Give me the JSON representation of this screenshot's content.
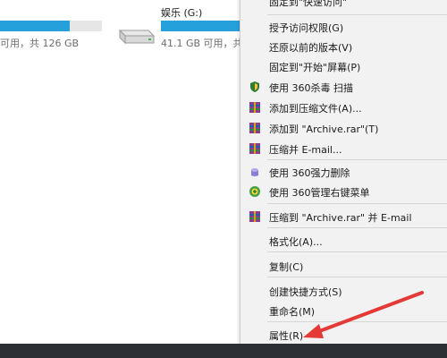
{
  "drives": {
    "c": {
      "used_fraction": 0.68,
      "info": "可用，共 126 GB",
      "bar_color": "#26a0da"
    },
    "g": {
      "name": "娱乐 (G:)",
      "info": "41.1 GB 可用，共",
      "used_fraction": 1.0,
      "icon": "hard-drive-icon",
      "bar_color": "#26a0da"
    }
  },
  "context_menu": {
    "items": [
      {
        "label": "固定到\"快速访问\"",
        "icon": ""
      },
      {
        "label": "授予访问权限(G)",
        "icon": ""
      },
      {
        "label": "还原以前的版本(V)",
        "icon": ""
      },
      {
        "label": "固定到\"开始\"屏幕(P)",
        "icon": ""
      },
      {
        "label": "使用 360杀毒 扫描",
        "icon": "360-antivirus-shield-icon"
      },
      {
        "label": "添加到压缩文件(A)...",
        "icon": "winrar-archive-icon"
      },
      {
        "label": "添加到 \"Archive.rar\"(T)",
        "icon": "winrar-archive-icon"
      },
      {
        "label": "压缩并 E-mail...",
        "icon": "winrar-archive-icon"
      },
      {
        "label": "使用 360强力删除",
        "icon": "360-force-delete-icon"
      },
      {
        "label": "使用 360管理右键菜单",
        "icon": "360-menu-manager-icon"
      },
      {
        "label": "压缩到 \"Archive.rar\" 并 E-mail",
        "icon": "winrar-archive-icon"
      },
      {
        "label": "格式化(A)...",
        "icon": ""
      },
      {
        "label": "复制(C)",
        "icon": ""
      },
      {
        "label": "创建快捷方式(S)",
        "icon": ""
      },
      {
        "label": "重命名(M)",
        "icon": ""
      },
      {
        "label": "属性(R)",
        "icon": ""
      }
    ]
  },
  "annotation": {
    "arrow_color": "#e53935",
    "arrow_target": "属性(R)"
  },
  "colors": {
    "menu_bg": "#f2f2f2",
    "taskbar": "#2c2f33",
    "accent": "#26a0da"
  }
}
